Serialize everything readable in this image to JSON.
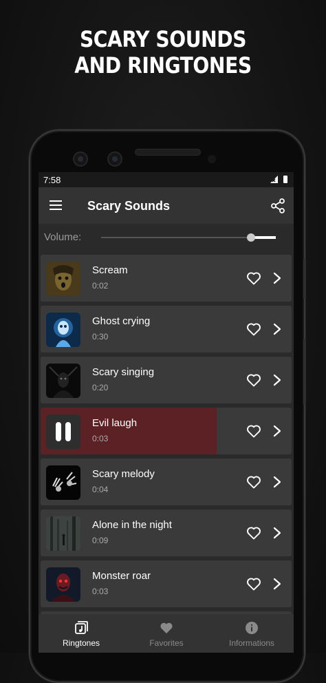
{
  "promo": {
    "line1": "SCARY SOUNDS",
    "line2": "AND RINGTONES"
  },
  "status_bar": {
    "time": "7:58"
  },
  "app_bar": {
    "title": "Scary Sounds",
    "icons": [
      "menu-icon",
      "share-icon"
    ]
  },
  "volume": {
    "label": "Volume:",
    "level": 0.86
  },
  "sounds": [
    {
      "name": "Scream",
      "duration": "0:02",
      "playing": false
    },
    {
      "name": "Ghost crying",
      "duration": "0:30",
      "playing": false
    },
    {
      "name": "Scary singing",
      "duration": "0:20",
      "playing": false
    },
    {
      "name": "Evil laugh",
      "duration": "0:03",
      "playing": true,
      "progress": 0.7
    },
    {
      "name": "Scary melody",
      "duration": "0:04",
      "playing": false
    },
    {
      "name": "Alone in the night",
      "duration": "0:09",
      "playing": false
    },
    {
      "name": "Monster roar",
      "duration": "0:03",
      "playing": false
    }
  ],
  "bottom_nav": [
    {
      "label": "Ringtones",
      "icon": "ringtones-icon",
      "active": true
    },
    {
      "label": "Favorites",
      "icon": "heart-icon",
      "active": false
    },
    {
      "label": "Informations",
      "icon": "info-icon",
      "active": false
    }
  ],
  "colors": {
    "playing_row": "#5b2125",
    "row": "#3a3a3a",
    "appbar": "#333333",
    "inactive_nav": "#8a8a8a"
  }
}
